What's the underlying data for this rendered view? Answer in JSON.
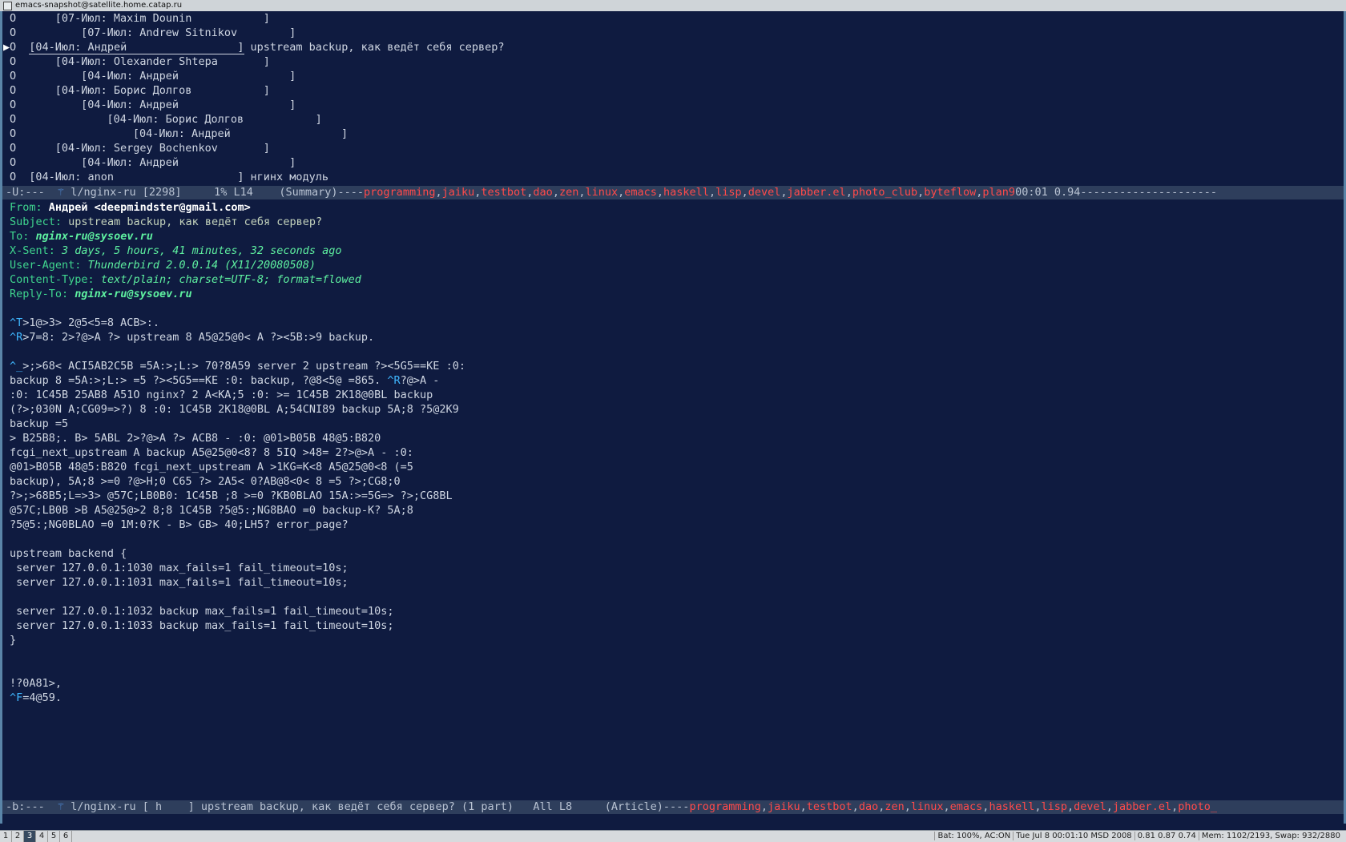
{
  "window": {
    "title": "emacs-snapshot@satellite.home.catap.ru"
  },
  "summary": {
    "lines": [
      {
        "mark": "O",
        "indent": 7,
        "text": "[07-Июл: Maxim Dounin           ]",
        "subject": "",
        "current": false
      },
      {
        "mark": "O",
        "indent": 11,
        "text": "[07-Июл: Andrew Sitnikov        ]",
        "subject": "",
        "current": false
      },
      {
        "mark": "O",
        "indent": 3,
        "text": "[04-Июл: Андрей                 ]",
        "subject": "upstream backup, как ведёт себя сервер?",
        "current": true
      },
      {
        "mark": "O",
        "indent": 7,
        "text": "[04-Июл: Olexander Shtepa       ]",
        "subject": "",
        "current": false
      },
      {
        "mark": "O",
        "indent": 11,
        "text": "[04-Июл: Андрей                 ]",
        "subject": "",
        "current": false
      },
      {
        "mark": "O",
        "indent": 7,
        "text": "[04-Июл: Борис Долгов           ]",
        "subject": "",
        "current": false
      },
      {
        "mark": "O",
        "indent": 11,
        "text": "[04-Июл: Андрей                 ]",
        "subject": "",
        "current": false
      },
      {
        "mark": "O",
        "indent": 15,
        "text": "[04-Июл: Борис Долгов           ]",
        "subject": "",
        "current": false
      },
      {
        "mark": "O",
        "indent": 19,
        "text": "[04-Июл: Андрей                 ]",
        "subject": "",
        "current": false
      },
      {
        "mark": "O",
        "indent": 7,
        "text": "[04-Июл: Sergey Bochenkov       ]",
        "subject": "",
        "current": false
      },
      {
        "mark": "O",
        "indent": 11,
        "text": "[04-Июл: Андрей                 ]",
        "subject": "",
        "current": false
      },
      {
        "mark": "O",
        "indent": 3,
        "text": "[04-Июл: anon                   ]",
        "subject": "нгинх модуль",
        "current": false
      }
    ]
  },
  "modeline_summary": {
    "left": "-U:---  ",
    "buffer": " l/nginx-ru [2298]     1% L14    (Summary)----",
    "groups": [
      "programming",
      "jaiku",
      "testbot",
      "dao",
      "zen",
      "linux",
      "emacs",
      "haskell",
      "lisp",
      "devel",
      "jabber.el",
      "photo_club",
      "byteflow",
      "plan9"
    ],
    "right": "00:01 0.94---------------------"
  },
  "article": {
    "headers": [
      {
        "name": "From:",
        "value": "Андрей <deepmindster@gmail.com>",
        "style": "from"
      },
      {
        "name": "Subject:",
        "value": "upstream backup, как ведёт себя сервер?",
        "style": ""
      },
      {
        "name": "To:",
        "value": "nginx-ru@sysoev.ru",
        "style": "itb"
      },
      {
        "name": "X-Sent:",
        "value": "3 days, 5 hours, 41 minutes, 32 seconds ago",
        "style": "it"
      },
      {
        "name": "User-Agent:",
        "value": "Thunderbird 2.0.0.14 (X11/20080508)",
        "style": "it"
      },
      {
        "name": "Content-Type:",
        "value": "text/plain; charset=UTF-8; format=flowed",
        "style": "it"
      },
      {
        "name": "Reply-To:",
        "value": "nginx-ru@sysoev.ru",
        "style": "itb"
      }
    ],
    "body_lines": [
      {
        "ctl": "",
        "text": ""
      },
      {
        "ctl": "^T",
        "text": ">1@>3> 2@5<5=8 ACB>:."
      },
      {
        "ctl": "^R",
        "text": ">7=8: 2>?@>A ?> upstream 8 A5@25@0< A ?><5B:>9 backup."
      },
      {
        "ctl": "",
        "text": ""
      },
      {
        "ctl": "^_",
        "text": ">;>68< ACI5AB2C5B =5A:>;L:> 70?8A59 server 2 upstream ?><5G5==KE :0:"
      },
      {
        "ctl": "",
        "text": "backup 8 =5A:>;L:> =5 ?><5G5==KE :0: backup, ?@8<5@ =865. ",
        "ctl2": "^R",
        "text2": "?@>A -"
      },
      {
        "ctl": "",
        "text": ":0: 1C45B 25AB8 A51O nginx? 2 A<KA;5 :0: >= 1C45B 2K18@0BL backup"
      },
      {
        "ctl": "",
        "text": "(?>;030N A;CG09=>?) 8 :0: 1C45B 2K18@0BL A;54CNI89 backup 5A;8 ?5@2K9"
      },
      {
        "ctl": "",
        "text": "backup =5"
      },
      {
        "ctl": "",
        "text": "> B25B8;. B> 5ABL 2>?@>A ?> ACB8 - :0: @01>B05B 48@5:B820"
      },
      {
        "ctl": "",
        "text": "fcgi_next_upstream A backup A5@25@0<8? 8 5IQ >48= 2?>@>A - :0:"
      },
      {
        "ctl": "",
        "text": "@01>B05B 48@5:B820 fcgi_next_upstream A >1KG=K<8 A5@25@0<8 (=5"
      },
      {
        "ctl": "",
        "text": "backup), 5A;8 >=0 ?@>H;0 C65 ?> 2A5< 0?AB@8<0< 8 =5 ?>;CG8;0"
      },
      {
        "ctl": "",
        "text": "?>;>68B5;L=>3> @57C;LB0B0: 1C45B ;8 >=0 ?KB0BLAO 15A:>=5G=> ?>;CG8BL"
      },
      {
        "ctl": "",
        "text": "@57C;LB0B >B A5@25@>2 8;8 1C45B ?5@5:;NG8BAO =0 backup-K? 5A;8"
      },
      {
        "ctl": "",
        "text": "?5@5:;NG0BLAO =0 1M:0?K - B> GB> 40;LH5? error_page?"
      },
      {
        "ctl": "",
        "text": ""
      },
      {
        "ctl": "",
        "text": "upstream backend {"
      },
      {
        "ctl": "",
        "text": " server 127.0.0.1:1030 max_fails=1 fail_timeout=10s;"
      },
      {
        "ctl": "",
        "text": " server 127.0.0.1:1031 max_fails=1 fail_timeout=10s;"
      },
      {
        "ctl": "",
        "text": ""
      },
      {
        "ctl": "",
        "text": " server 127.0.0.1:1032 backup max_fails=1 fail_timeout=10s;"
      },
      {
        "ctl": "",
        "text": " server 127.0.0.1:1033 backup max_fails=1 fail_timeout=10s;"
      },
      {
        "ctl": "",
        "text": "}"
      },
      {
        "ctl": "",
        "text": ""
      },
      {
        "ctl": "",
        "text": ""
      },
      {
        "ctl": "",
        "text": "!?0A81>,"
      },
      {
        "ctl": "^F",
        "text": "=4@59."
      }
    ]
  },
  "modeline_article": {
    "left": "-b:---  ",
    "buffer": " l/nginx-ru [ h    ] upstream backup, как ведёт себя сервер? (1 part)   All L8     (Article)----",
    "groups": [
      "programming",
      "jaiku",
      "testbot",
      "dao",
      "zen",
      "linux",
      "emacs",
      "haskell",
      "lisp",
      "devel",
      "jabber.el",
      "photo_"
    ]
  },
  "taskbar": {
    "workspaces": [
      "1",
      "2",
      "3",
      "4",
      "5",
      "6"
    ],
    "active_workspace": "3",
    "status": [
      "Bat: 100%, AC:ON",
      "Tue Jul  8 00:01:10 MSD 2008",
      "0.81 0.87 0.74",
      "Mem: 1102/2193, Swap: 932/2880"
    ]
  },
  "colors": {
    "background": "#0f1b40",
    "group": "#ff4a4a",
    "header_name": "#3fd58e",
    "control": "#3fb7ff"
  }
}
